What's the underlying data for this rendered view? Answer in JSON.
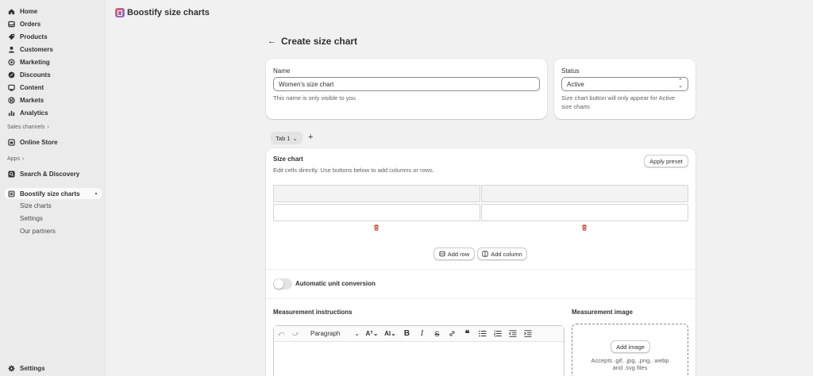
{
  "sidebar": {
    "items": [
      {
        "label": "Home",
        "icon": "home-icon"
      },
      {
        "label": "Orders",
        "icon": "orders-icon"
      },
      {
        "label": "Products",
        "icon": "products-icon"
      },
      {
        "label": "Customers",
        "icon": "customers-icon"
      },
      {
        "label": "Marketing",
        "icon": "marketing-icon"
      },
      {
        "label": "Discounts",
        "icon": "discounts-icon"
      },
      {
        "label": "Content",
        "icon": "content-icon"
      },
      {
        "label": "Markets",
        "icon": "markets-icon"
      },
      {
        "label": "Analytics",
        "icon": "analytics-icon"
      }
    ],
    "sales_channels_label": "Sales channels",
    "online_store": "Online Store",
    "apps_label": "Apps",
    "search_discovery": "Search & Discovery",
    "app_name": "Boostify size charts",
    "app_subitems": [
      "Size charts",
      "Settings",
      "Our partners"
    ],
    "settings": "Settings"
  },
  "header": {
    "app_title": "Boostify size charts"
  },
  "page": {
    "title": "Create size chart"
  },
  "name_card": {
    "label": "Name",
    "value": "Women's size chart",
    "help": "This name is only visible to you"
  },
  "status_card": {
    "label": "Status",
    "value": "Active",
    "help_line1": "Size chart button will only appear for Active",
    "help_line2": "size charts"
  },
  "tabs": {
    "active": "Tab 1",
    "add": "+"
  },
  "size_chart": {
    "title": "Size chart",
    "subtitle": "Edit cells directly. Use buttons below to add columns or rows.",
    "apply_preset": "Apply preset",
    "add_row": "Add row",
    "add_column": "Add column"
  },
  "unit_conversion": {
    "label": "Automatic unit conversion",
    "enabled": false
  },
  "instructions": {
    "title": "Measurement instructions",
    "paragraph": "Paragraph"
  },
  "image": {
    "title": "Measurement image",
    "button": "Add image",
    "help_line1": "Accepts .gif, .jpg, .png, .webp",
    "help_line2": "and .svg files"
  },
  "colors": {
    "sidebar_bg": "#ebebeb",
    "main_bg": "#f1f1f1",
    "card_bg": "#ffffff",
    "delete_red": "#c5280c"
  }
}
